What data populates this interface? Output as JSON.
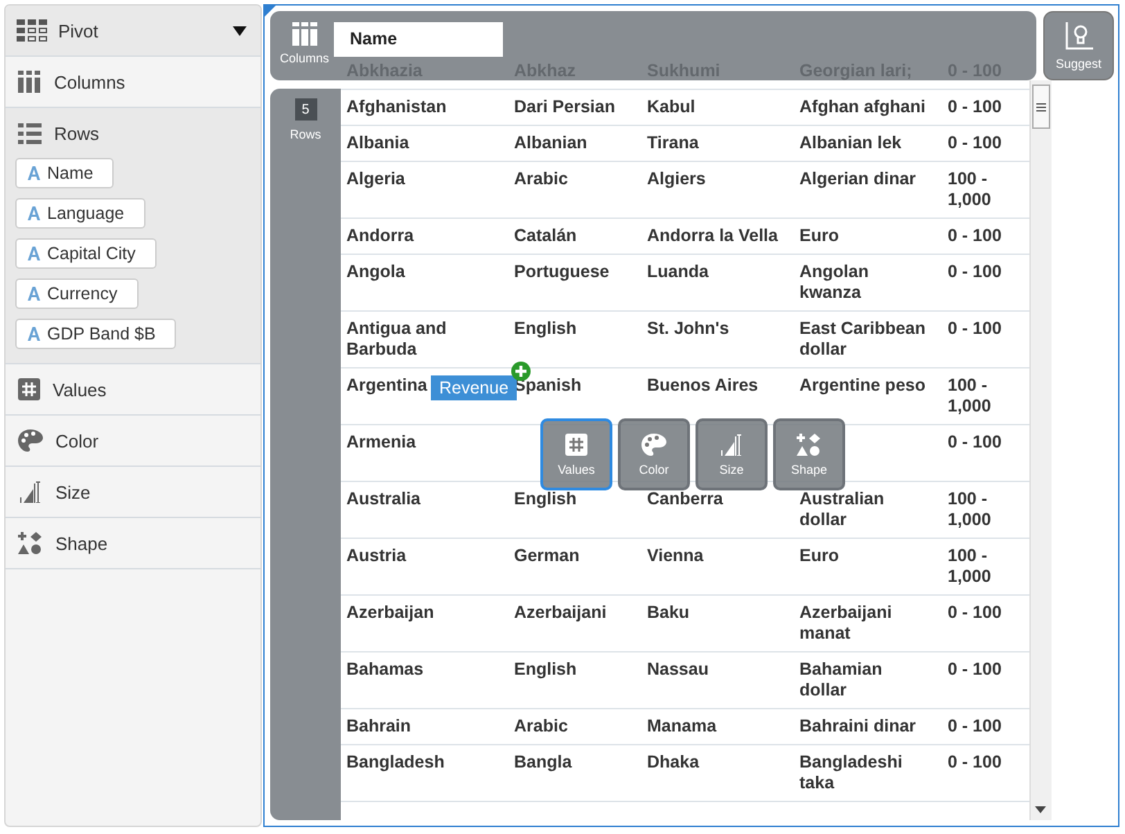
{
  "sidebar": {
    "title": "Pivot",
    "sections": [
      {
        "kind": "columns",
        "label": "Columns"
      },
      {
        "kind": "rows",
        "label": "Rows",
        "fields": [
          "Name",
          "Language",
          "Capital City",
          "Currency",
          "GDP Band $B"
        ]
      },
      {
        "kind": "values",
        "label": "Values"
      },
      {
        "kind": "color",
        "label": "Color"
      },
      {
        "kind": "size",
        "label": "Size"
      },
      {
        "kind": "shape",
        "label": "Shape"
      }
    ]
  },
  "canvas": {
    "columns_zone": {
      "label": "Columns",
      "field": "Name"
    },
    "rows_zone": {
      "label": "Rows",
      "count": "5"
    },
    "suggest_button": "Suggest",
    "table": {
      "rows": [
        [
          "Abkhazia",
          "Abkhaz",
          "Sukhumi",
          "Georgian lari;",
          "0 - 100"
        ],
        [
          "Afghanistan",
          "Dari Persian",
          "Kabul",
          "Afghan afghani",
          "0 - 100"
        ],
        [
          "Albania",
          "Albanian",
          "Tirana",
          "Albanian lek",
          "0 - 100"
        ],
        [
          "Algeria",
          "Arabic",
          "Algiers",
          "Algerian dinar",
          "100 - 1,000"
        ],
        [
          "Andorra",
          "Catalán",
          "Andorra la Vella",
          "Euro",
          "0 - 100"
        ],
        [
          "Angola",
          "Portuguese",
          "Luanda",
          "Angolan kwanza",
          "0 - 100"
        ],
        [
          "Antigua and Barbuda",
          "English",
          "St. John's",
          "East Caribbean dollar",
          "0 - 100"
        ],
        [
          "Argentina",
          "Spanish",
          "Buenos Aires",
          "Argentine peso",
          "100 - 1,000"
        ],
        [
          "Armenia",
          null,
          null,
          null,
          "0 - 100"
        ],
        [
          "Australia",
          "English",
          "Canberra",
          "Australian dollar",
          "100 - 1,000"
        ],
        [
          "Austria",
          "German",
          "Vienna",
          "Euro",
          "100 - 1,000"
        ],
        [
          "Azerbaijan",
          "Azerbaijani",
          "Baku",
          "Azerbaijani manat",
          "0 - 100"
        ],
        [
          "Bahamas",
          "English",
          "Nassau",
          "Bahamian dollar",
          "0 - 100"
        ],
        [
          "Bahrain",
          "Arabic",
          "Manama",
          "Bahraini dinar",
          "0 - 100"
        ],
        [
          "Bangladesh",
          "Bangla",
          "Dhaka",
          "Bangladeshi taka",
          "0 - 100"
        ]
      ]
    },
    "drag_chip": "Revenue",
    "drop_targets": [
      {
        "kind": "values",
        "label": "Values",
        "selected": true
      },
      {
        "kind": "color",
        "label": "Color",
        "selected": false
      },
      {
        "kind": "size",
        "label": "Size",
        "selected": false
      },
      {
        "kind": "shape",
        "label": "Shape",
        "selected": false
      }
    ]
  }
}
